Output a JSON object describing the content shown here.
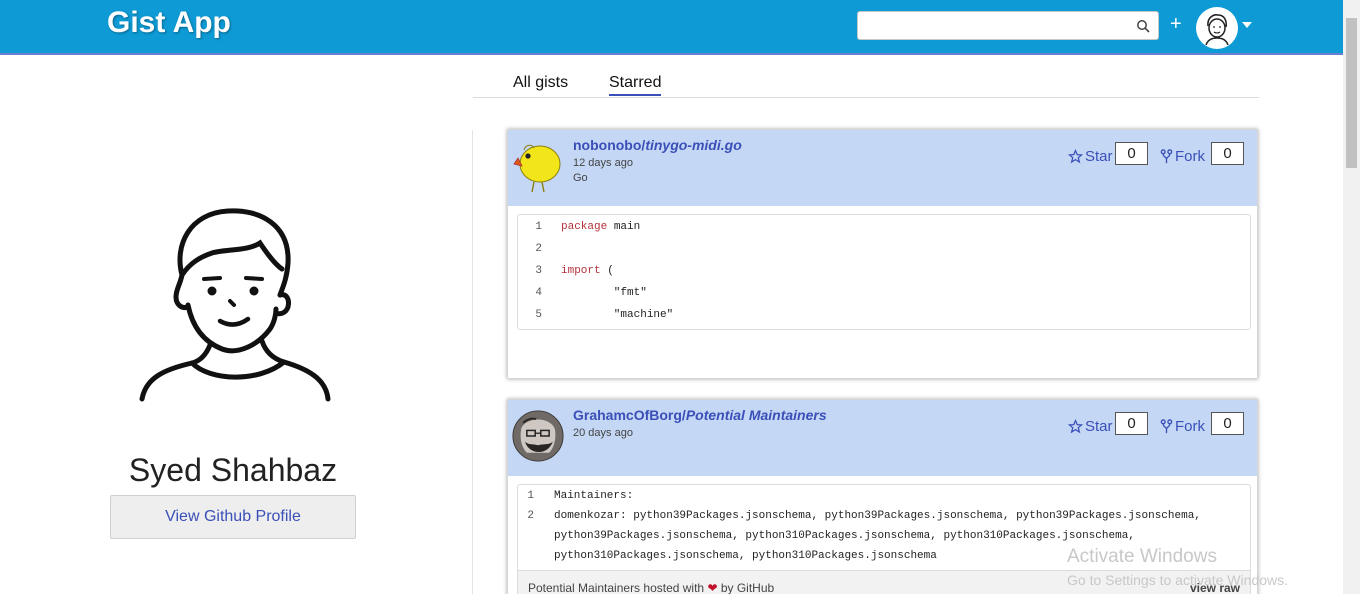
{
  "app": {
    "title": "Gist App"
  },
  "header": {
    "search_placeholder": "",
    "plus_label": "+"
  },
  "profile": {
    "name": "Syed Shahbaz",
    "button_label": "View Github Profile"
  },
  "tabs": [
    {
      "label": "All gists"
    },
    {
      "label": "Starred"
    }
  ],
  "gists": [
    {
      "owner": "nobonobo",
      "separator": "/",
      "name": "tinygo-midi.go",
      "time": "12 days ago",
      "language": "Go",
      "star_label": "Star",
      "star_count": "0",
      "fork_label": "Fork",
      "fork_count": "0",
      "lines": [
        {
          "n": "1",
          "kw": "package",
          "rest": " main"
        },
        {
          "n": "2",
          "kw": "",
          "rest": ""
        },
        {
          "n": "3",
          "kw": "import",
          "rest": " ("
        },
        {
          "n": "4",
          "kw": "",
          "rest": "        \"fmt\""
        },
        {
          "n": "5",
          "kw": "",
          "rest": "        \"machine\""
        }
      ]
    },
    {
      "owner": "GrahamcOfBorg",
      "separator": "/",
      "name": "Potential Maintainers",
      "time": "20 days ago",
      "star_label": "Star",
      "star_count": "0",
      "fork_label": "Fork",
      "fork_count": "0",
      "lines": [
        {
          "n": "1",
          "text": "Maintainers:"
        },
        {
          "n": "2",
          "text": "domenkozar: python39Packages.jsonschema, python39Packages.jsonschema, python39Packages.jsonschema, python39Packages.jsonschema, python310Packages.jsonschema, python310Packages.jsonschema, python310Packages.jsonschema, python310Packages.jsonschema"
        }
      ],
      "footer": {
        "file": "Potential Maintainers",
        "hosted": " hosted with ",
        "by": " by ",
        "github": "GitHub",
        "view_raw": "view raw"
      }
    }
  ],
  "watermark": {
    "line1": "Activate Windows",
    "line2": "Go to Settings to activate Windows."
  }
}
